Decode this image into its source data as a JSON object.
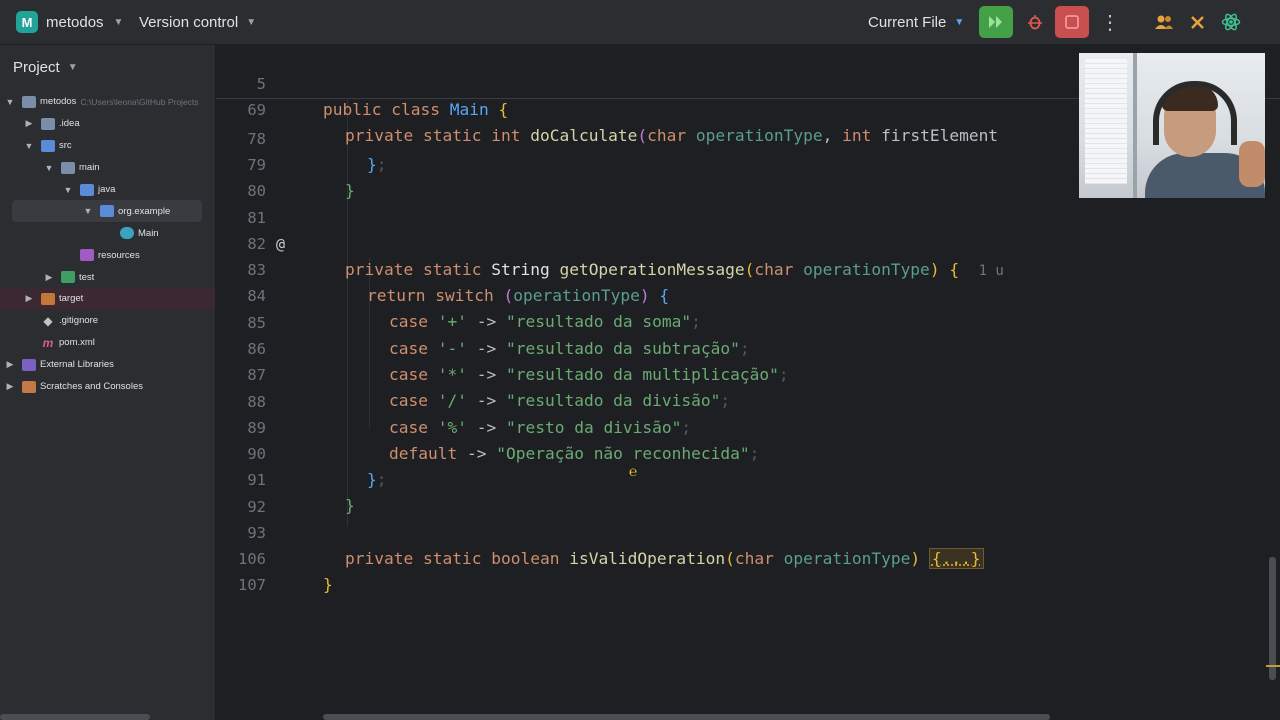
{
  "title_bar": {
    "project_badge": "M",
    "project_name": "metodos",
    "version_control": "Version control",
    "run_config": "Current File",
    "icons": [
      "run-icon",
      "debug-icon",
      "stop-icon",
      "more-icon",
      "collaborate-icon",
      "build-tools-icon",
      "ai-assistant-icon"
    ]
  },
  "project_panel": {
    "title": "Project",
    "tree": [
      {
        "label": "metodos",
        "hint": "C:\\Users\\leona\\GitHub Projects",
        "depth": 0,
        "expanded": true,
        "icon": "folder-icon"
      },
      {
        "label": ".idea",
        "depth": 1,
        "expanded": false,
        "icon": "folder-icon"
      },
      {
        "label": "src",
        "depth": 1,
        "expanded": true,
        "icon": "source-folder-icon"
      },
      {
        "label": "main",
        "depth": 2,
        "expanded": true,
        "icon": "folder-icon"
      },
      {
        "label": "java",
        "depth": 3,
        "expanded": true,
        "icon": "source-root-icon"
      },
      {
        "label": "org.example",
        "depth": 4,
        "expanded": true,
        "icon": "package-icon",
        "selected": true
      },
      {
        "label": "Main",
        "depth": 5,
        "icon": "class-icon"
      },
      {
        "label": "resources",
        "depth": 3,
        "icon": "resources-folder-icon"
      },
      {
        "label": "test",
        "depth": 2,
        "expanded": false,
        "icon": "test-folder-icon"
      },
      {
        "label": "target",
        "depth": 1,
        "expanded": false,
        "icon": "excluded-folder-icon",
        "excluded": true
      },
      {
        "label": ".gitignore",
        "depth": 1,
        "icon": "git-icon"
      },
      {
        "label": "pom.xml",
        "depth": 1,
        "icon": "maven-icon"
      },
      {
        "label": "External Libraries",
        "depth": 0,
        "expanded": false,
        "icon": "library-icon"
      },
      {
        "label": "Scratches and Consoles",
        "depth": 0,
        "expanded": false,
        "icon": "scratches-icon"
      }
    ]
  },
  "editor": {
    "sticky_lines": [
      {
        "number": "5",
        "text": "public class Main {"
      },
      {
        "number": "69",
        "text": "private static int doCalculate(char operationType, int firstElement"
      }
    ],
    "lines": [
      {
        "number": "78",
        "text": "};"
      },
      {
        "number": "79",
        "text": "}"
      },
      {
        "number": "80",
        "text": ""
      },
      {
        "number": "81",
        "text": "private static String getOperationMessage(char operationType) {",
        "gutter": "@",
        "hint": "1 u"
      },
      {
        "number": "82",
        "text": ""
      },
      {
        "number": "83",
        "text": "return switch (operationType) {"
      },
      {
        "number": "84",
        "text": "case '+' -> \"resultado da soma\";"
      },
      {
        "number": "85",
        "text": "case '-' -> \"resultado da subtração\";"
      },
      {
        "number": "86",
        "text": "case '*' -> \"resultado da multiplicação\";"
      },
      {
        "number": "87",
        "text": "case '/' -> \"resultado da divisão\";"
      },
      {
        "number": "88",
        "text": "case '%' -> \"resto da divisão\";"
      },
      {
        "number": "89",
        "text": "default -> \"Operação não reconhecida\";"
      },
      {
        "number": "90",
        "text": "};"
      },
      {
        "number": "91",
        "text": "}"
      },
      {
        "number": "92",
        "text": ""
      },
      {
        "number": "93",
        "text": "private static boolean isValidOperation(char operationType) {...}"
      },
      {
        "number": "106",
        "text": "}"
      },
      {
        "number": "107",
        "text": ""
      }
    ],
    "tokens": {
      "kw_public": "public",
      "kw_class": "class",
      "cls_main": "Main",
      "kw_private": "private",
      "kw_static": "static",
      "kw_int": "int",
      "fn_docalc": "doCalculate",
      "kw_char": "char",
      "p_optype": "operationType",
      "p_first": "firstElement",
      "ty_string": "String",
      "fn_getmsg": "getOperationMessage",
      "kw_return": "return",
      "kw_switch": "switch",
      "kw_case": "case",
      "kw_default": "default",
      "kw_boolean": "boolean",
      "fn_isvalid": "isValidOperation",
      "c_plus": "'+'",
      "c_minus": "'-'",
      "c_mul": "'*'",
      "c_div": "'/'",
      "c_mod": "'%'",
      "arrow": "->",
      "s_soma": "\"resultado da soma\"",
      "s_sub": "\"resultado da subtração\"",
      "s_mul": "\"resultado da multiplicação\"",
      "s_div": "\"resultado da divisão\"",
      "s_mod": "\"resto da divisão\"",
      "s_default": "\"Operação não reconhecida\"",
      "folded": "{...}",
      "usages_hint": "1 u"
    }
  },
  "colors": {
    "keyword": "#cf8e6d",
    "function": "#56a8f5",
    "string": "#6aab73",
    "parameter": "#5a9e8e",
    "run_green": "#43a047",
    "stop_red": "#c94f4f",
    "project_badge": "#21a39a"
  }
}
